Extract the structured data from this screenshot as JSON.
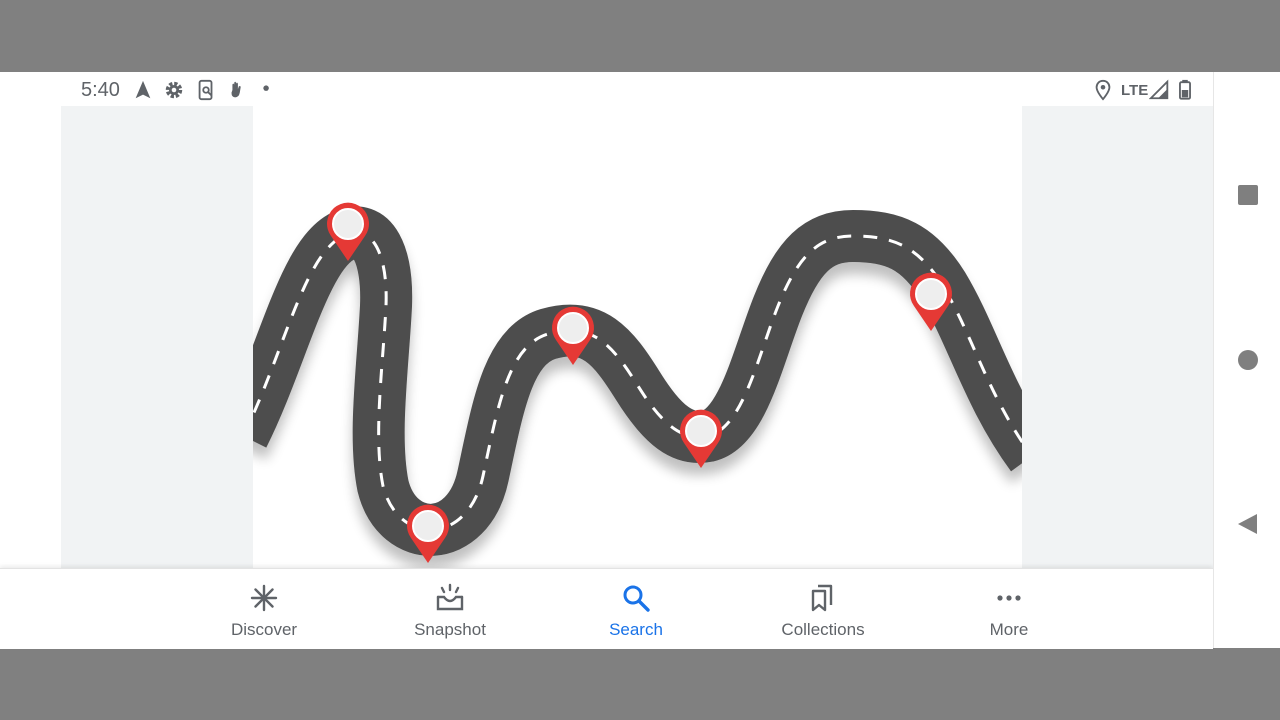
{
  "status_bar": {
    "time": "5:40",
    "left_icons": [
      "navigation-arrow-icon",
      "gear-icon",
      "screen-record-icon",
      "hand-gesture-icon",
      "notification-dot-icon"
    ],
    "network_label": "LTE",
    "right_icons": [
      "location-pin-icon",
      "signal-icon",
      "battery-icon"
    ]
  },
  "image": {
    "subject": "winding road with red map pins",
    "pin_color": "#e53935",
    "road_color": "#4d4d4d"
  },
  "bottom_nav": {
    "active_index": 2,
    "active_color": "#1a73e8",
    "items": [
      {
        "label": "Discover",
        "icon": "asterisk-icon"
      },
      {
        "label": "Snapshot",
        "icon": "snapshot-icon"
      },
      {
        "label": "Search",
        "icon": "search-icon"
      },
      {
        "label": "Collections",
        "icon": "bookmarks-icon"
      },
      {
        "label": "More",
        "icon": "more-horizontal-icon"
      }
    ]
  },
  "system_nav": [
    "overview-square-icon",
    "home-circle-icon",
    "back-triangle-icon"
  ]
}
